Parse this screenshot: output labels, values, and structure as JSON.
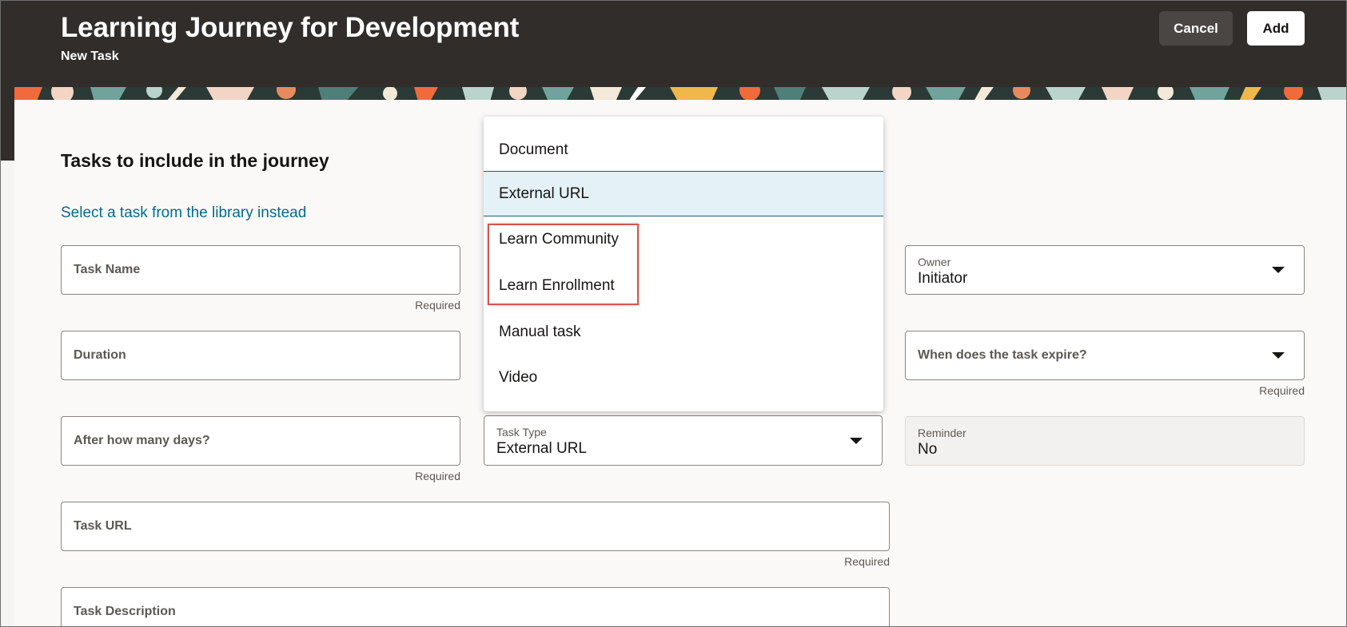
{
  "header": {
    "title": "Learning Journey for Development",
    "subtitle": "New Task",
    "cancel_label": "Cancel",
    "add_label": "Add"
  },
  "section": {
    "heading": "Tasks to include in the journey",
    "library_link": "Select a task from the library instead"
  },
  "form": {
    "task_name": {
      "placeholder": "Task Name",
      "required": "Required"
    },
    "duration": {
      "placeholder": "Duration"
    },
    "after_days": {
      "placeholder": "After how many days?",
      "required": "Required"
    },
    "task_type": {
      "label": "Task Type",
      "value": "External URL"
    },
    "owner": {
      "label": "Owner",
      "value": "Initiator"
    },
    "expire": {
      "placeholder": "When does the task expire?",
      "required": "Required"
    },
    "reminder": {
      "label": "Reminder",
      "value": "No"
    },
    "task_url": {
      "placeholder": "Task URL",
      "required": "Required"
    },
    "task_description": {
      "placeholder": "Task Description"
    }
  },
  "dropdown": {
    "options": [
      "Document",
      "External URL",
      "Learn Community",
      "Learn Enrollment",
      "Manual task",
      "Video"
    ],
    "selected": "External URL"
  },
  "colors": {
    "header_bg": "#312d2a",
    "link": "#006b8f",
    "selected_option_bg": "#e4f1f7",
    "highlight_box": "#d9534f"
  }
}
